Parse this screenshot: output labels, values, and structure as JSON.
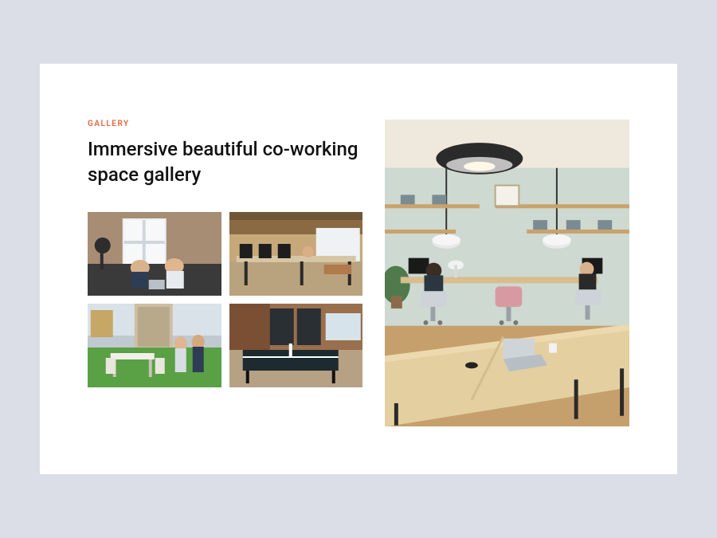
{
  "gallery": {
    "eyebrow": "GALLERY",
    "title": "Immersive beautiful co-working space gallery",
    "thumbnails": [
      {
        "name": "thumb-loft-window-workspace"
      },
      {
        "name": "thumb-open-office-desks"
      },
      {
        "name": "thumb-outdoor-terrace-seating"
      },
      {
        "name": "thumb-brick-gameroom-pingpong"
      }
    ],
    "hero": {
      "name": "hero-shared-desk-room"
    }
  },
  "colors": {
    "accent": "#e7653d",
    "page_bg": "#dbdee6",
    "card_bg": "#ffffff"
  }
}
